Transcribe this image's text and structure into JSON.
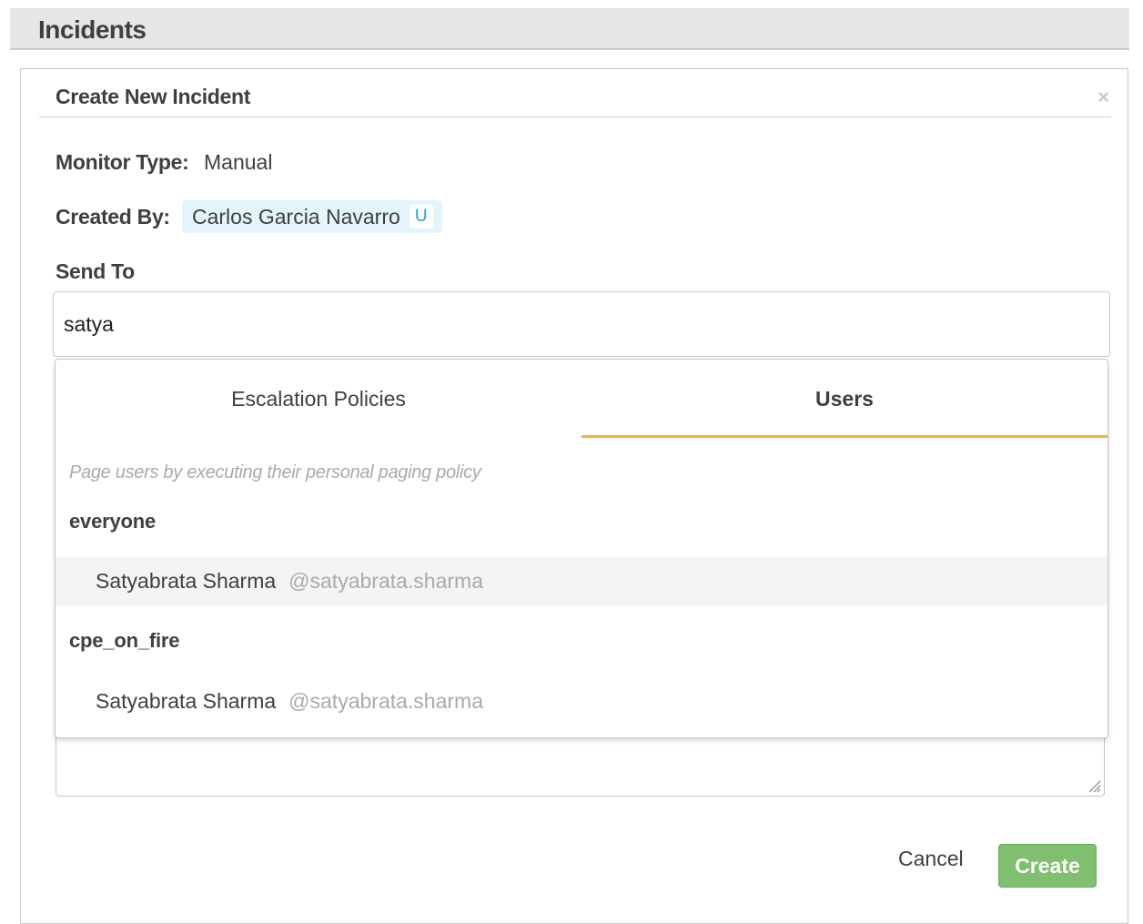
{
  "page": {
    "title": "Incidents"
  },
  "modal": {
    "title": "Create New Incident",
    "close_icon": "×",
    "monitor_type_label": "Monitor Type:",
    "monitor_type_value": "Manual",
    "created_by_label": "Created By:",
    "created_by_name": "Carlos Garcia Navarro",
    "created_by_badge": "U",
    "send_to_label": "Send To",
    "send_to_value": "satya"
  },
  "dropdown": {
    "tabs": [
      {
        "label": "Escalation Policies",
        "active": false
      },
      {
        "label": "Users",
        "active": true
      }
    ],
    "hint": "Page users by executing their personal paging policy",
    "groups": [
      {
        "label": "everyone",
        "users": [
          {
            "name": "Satyabrata Sharma",
            "handle": "@satyabrata.sharma",
            "highlighted": true
          }
        ]
      },
      {
        "label": "cpe_on_fire",
        "users": [
          {
            "name": "Satyabrata Sharma",
            "handle": "@satyabrata.sharma",
            "highlighted": false
          }
        ]
      }
    ]
  },
  "footer": {
    "cancel_label": "Cancel",
    "create_label": "Create"
  },
  "colors": {
    "accent_tab": "#f5b042",
    "create_button": "#7fbf6f",
    "chip_bg": "#e3f5fb",
    "badge_text": "#1ea4c8"
  }
}
